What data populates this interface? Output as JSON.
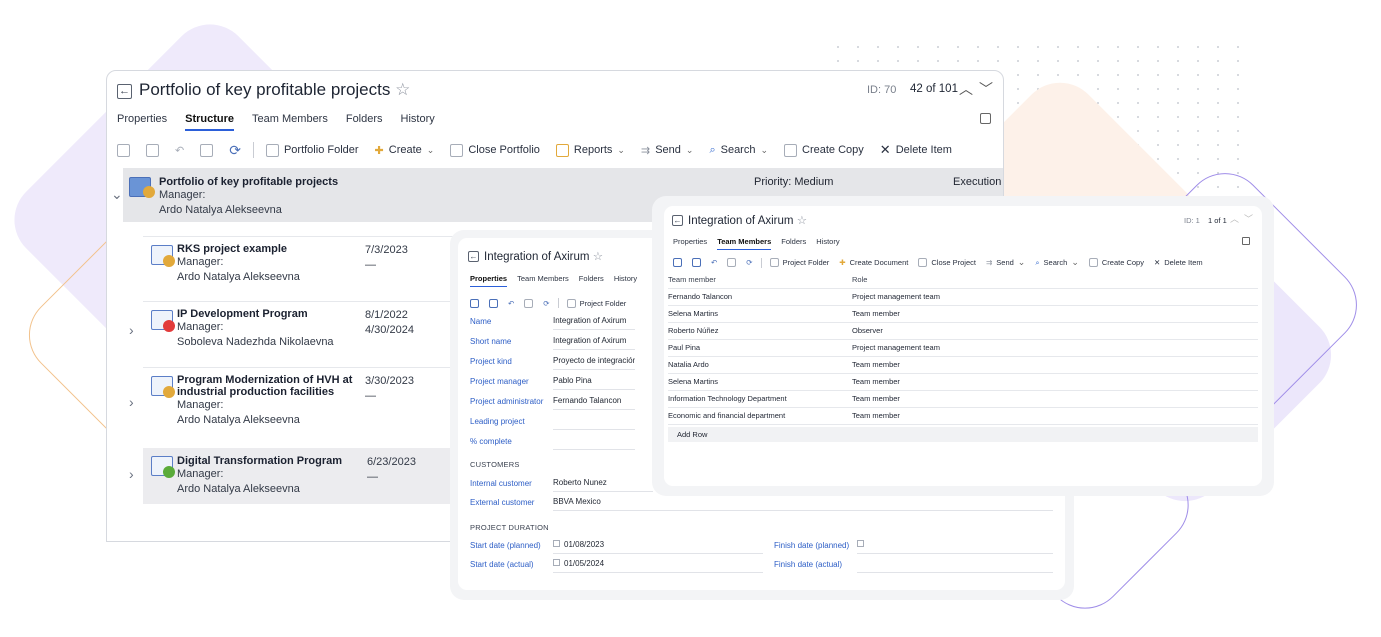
{
  "main": {
    "title": "Portfolio of key profitable projects",
    "id_label": "ID: 70",
    "position": "42 of 101",
    "tabs": [
      "Properties",
      "Structure",
      "Team Members",
      "Folders",
      "History"
    ],
    "active_tab": "Structure",
    "toolbar": {
      "portfolio_folder": "Portfolio Folder",
      "create": "Create",
      "close_portfolio": "Close Portfolio",
      "reports": "Reports",
      "send": "Send",
      "search": "Search",
      "create_copy": "Create Copy",
      "delete_item": "Delete Item"
    },
    "root": {
      "name": "Portfolio of key profitable projects",
      "manager_label": "Manager:",
      "manager": "Ardo Natalya Alekseevna",
      "priority": "Priority: Medium",
      "status": "Execution"
    },
    "items": [
      {
        "name": "RKS project example",
        "manager_label": "Manager:",
        "manager": "Ardo Natalya Alekseevna",
        "date1": "7/3/2023",
        "date2": "—",
        "dot": "#e2a93b"
      },
      {
        "name": "IP Development Program",
        "manager_label": "Manager:",
        "manager": "Soboleva Nadezhda Nikolaevna",
        "date1": "8/1/2022",
        "date2": "4/30/2024",
        "dot": "#e23b3b"
      },
      {
        "name_line1": "Program Modernization of HVH at",
        "name_line2": "industrial production facilities",
        "manager_label": "Manager:",
        "manager": "Ardo Natalya Alekseevna",
        "date1": "3/30/2023",
        "date2": "—",
        "dot": "#e2a93b"
      },
      {
        "name": "Digital Transformation Program",
        "manager_label": "Manager:",
        "manager": "Ardo Natalya Alekseevna",
        "date1": "6/23/2023",
        "date2": "—",
        "dot": "#5aab3a"
      }
    ]
  },
  "props": {
    "title": "Integration of Axirum",
    "tabs": [
      "Properties",
      "Team Members",
      "Folders",
      "History"
    ],
    "toolbar": {
      "project_folder": "Project Folder"
    },
    "fields": [
      {
        "label": "Name",
        "value": "Integration of Axirum"
      },
      {
        "label": "Short name",
        "value": "Integration of Axirum"
      },
      {
        "label": "Project kind",
        "value": "Proyecto de integración de te"
      },
      {
        "label": "Project manager",
        "value": "Pablo Pina"
      },
      {
        "label": "Project administrator",
        "value": "Fernando Talancon"
      },
      {
        "label": "Leading project",
        "value": ""
      },
      {
        "label": "% complete",
        "value": ""
      }
    ],
    "customers_heading": "CUSTOMERS",
    "customers": [
      {
        "label": "Internal customer",
        "value": "Roberto Nunez"
      },
      {
        "label": "External customer",
        "value": "BBVA Mexico"
      }
    ],
    "duration_heading": "PROJECT DURATION",
    "start_planned_label": "Start date (planned)",
    "start_planned": "01/08/2023",
    "start_actual_label": "Start date (actual)",
    "start_actual": "01/05/2024",
    "finish_planned_label": "Finish date (planned)",
    "finish_actual_label": "Finish date (actual)"
  },
  "team": {
    "title": "Integration of Axirum",
    "id_label": "ID: 1",
    "position": "1 of 1",
    "tabs": [
      "Properties",
      "Team Members",
      "Folders",
      "History"
    ],
    "active_tab": "Team Members",
    "toolbar": {
      "project_folder": "Project Folder",
      "create_document": "Create Document",
      "close_project": "Close Project",
      "send": "Send",
      "search": "Search",
      "create_copy": "Create Copy",
      "delete_item": "Delete Item"
    },
    "columns": [
      "Team member",
      "Role"
    ],
    "rows": [
      [
        "Fernando Talancon",
        "Project management team"
      ],
      [
        "Selena Martins",
        "Team member"
      ],
      [
        "Roberto Núñez",
        "Observer"
      ],
      [
        "Paul Pina",
        "Project management team"
      ],
      [
        "Natalia Ardo",
        "Team member"
      ],
      [
        "Selena Martins",
        "Team member"
      ],
      [
        "Information Technology Department",
        "Team member"
      ],
      [
        "Economic and financial department",
        "Team member"
      ]
    ],
    "add_row": "Add Row"
  }
}
